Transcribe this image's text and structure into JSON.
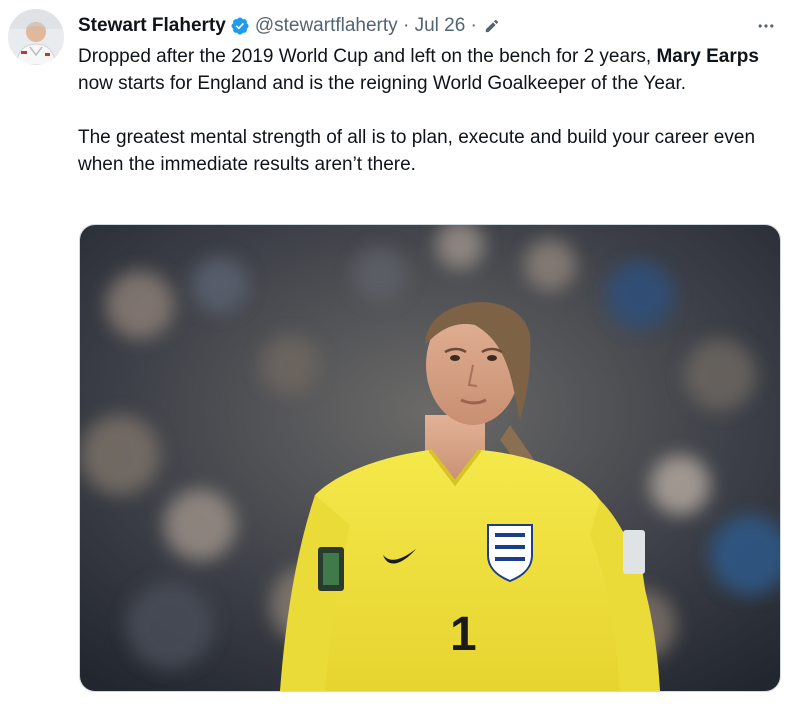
{
  "tweet": {
    "author": {
      "display_name": "Stewart Flaherty",
      "handle": "@stewartflaherty",
      "verified": true,
      "avatar_icon": "profile-photo"
    },
    "separator": "·",
    "date": "Jul 26",
    "edited_icon": "pen-icon",
    "more_icon": "more-options-icon",
    "text": {
      "p1_before": "Dropped after the 2019 World Cup and left on the bench for 2 years, ",
      "p1_bold": "Mary Earps",
      "p1_after": " now starts for England and is the reigning World Goalkeeper of the Year.",
      "p2": "The greatest mental strength of all is to plan, execute and build your career even when the immediate results aren’t there."
    },
    "media": {
      "kit_number": "1"
    }
  },
  "colors": {
    "verified_blue": "#1d9bf0",
    "muted_text": "#536471",
    "jersey_yellow": "#f2e33a"
  }
}
